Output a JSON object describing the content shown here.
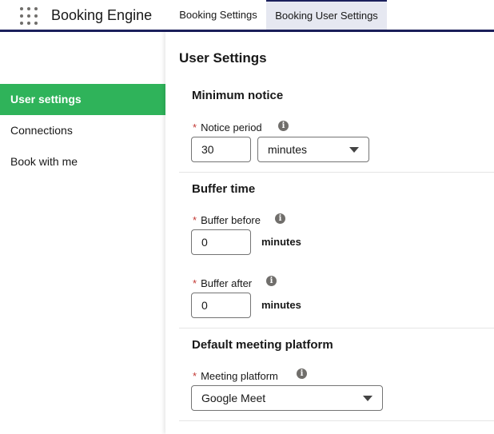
{
  "header": {
    "app_name": "Booking Engine",
    "tabs": [
      {
        "label": "Booking Settings",
        "active": false
      },
      {
        "label": "Booking User Settings",
        "active": true
      }
    ]
  },
  "sidebar": {
    "items": [
      {
        "label": "User settings",
        "active": true
      },
      {
        "label": "Connections",
        "active": false
      },
      {
        "label": "Book with me",
        "active": false
      }
    ]
  },
  "main": {
    "title": "User Settings",
    "minimum_notice": {
      "title": "Minimum notice",
      "notice_period_label": "Notice period",
      "notice_period_value": "30",
      "notice_period_unit": "minutes"
    },
    "buffer_time": {
      "title": "Buffer time",
      "buffer_before_label": "Buffer before",
      "buffer_before_value": "0",
      "buffer_after_label": "Buffer after",
      "buffer_after_value": "0",
      "unit": "minutes"
    },
    "meeting_platform": {
      "title": "Default meeting platform",
      "label": "Meeting platform",
      "value": "Google Meet"
    },
    "required_marker": "*",
    "info_glyph": "i"
  },
  "colors": {
    "accent": "#2fb35a",
    "brand_line": "#1b1f5c",
    "active_tab_bg": "#e6e8f1",
    "required": "#c23934"
  }
}
